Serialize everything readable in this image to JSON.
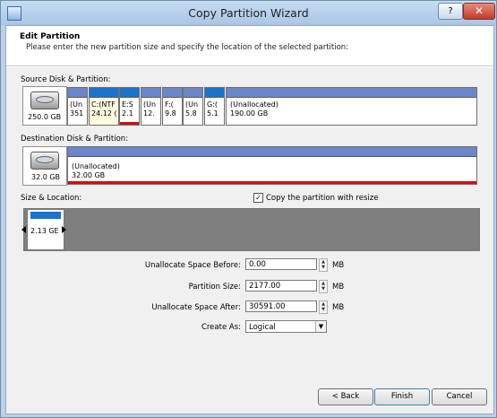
{
  "window": {
    "title": "Copy Partition Wizard",
    "help_label": "?",
    "close_label": "✕"
  },
  "header": {
    "title": "Edit Partition",
    "subtitle": "Please enter the new partition size and specify the location of the selected partition:"
  },
  "source": {
    "label": "Source Disk & Partition:",
    "disk_size": "250.0 GB",
    "partitions": [
      {
        "line1": "(Un",
        "line2": "351",
        "bar_color": "#6b86c9",
        "underline": ""
      },
      {
        "line1": "C:(NTF",
        "line2": "24.12 (",
        "bar_color": "#1a73ce",
        "underline": ""
      },
      {
        "line1": "E:S",
        "line2": "2.1",
        "bar_color": "#1a73ce",
        "underline": "#d01010"
      },
      {
        "line1": "(Un",
        "line2": "12.",
        "bar_color": "#6b86c9",
        "underline": ""
      },
      {
        "line1": "F:(",
        "line2": "9.8",
        "bar_color": "#6b86c9",
        "underline": ""
      },
      {
        "line1": "(Un",
        "line2": "5.8",
        "bar_color": "#6b86c9",
        "underline": ""
      },
      {
        "line1": "G:(",
        "line2": "5.1",
        "bar_color": "#1a73ce",
        "underline": ""
      },
      {
        "line1": "(Unallocated)",
        "line2": "190.00 GB",
        "bar_color": "#6b86c9",
        "underline": ""
      }
    ]
  },
  "destination": {
    "label": "Destination Disk & Partition:",
    "disk_size": "32.0 GB",
    "partition_line1": "(Unallocated)",
    "partition_line2": "32.00 GB"
  },
  "size_location": {
    "label": "Size & Location:",
    "copy_resize_label": "Copy the partition with resize",
    "copy_resize_checked": true,
    "block_text": "2.13 GE"
  },
  "fields": {
    "unalloc_before_label": "Unallocate Space Before:",
    "unalloc_before_value": "0.00",
    "partition_size_label": "Partition Size:",
    "partition_size_value": "2177.00",
    "unalloc_after_label": "Unallocate Space After:",
    "unalloc_after_value": "30591.00",
    "unit": "MB",
    "create_as_label": "Create As:",
    "create_as_value": "Logical"
  },
  "buttons": {
    "back": "< Back",
    "finish": "Finish",
    "cancel": "Cancel"
  },
  "colors": {
    "primary_partition": "#1a73ce",
    "logical_partition": "#6b86c9",
    "selected_underline": "#d01010"
  }
}
